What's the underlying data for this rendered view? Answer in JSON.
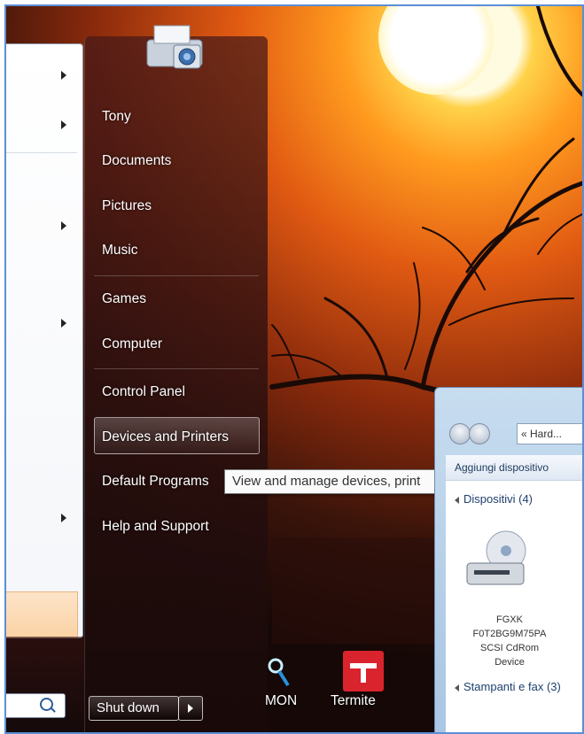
{
  "start_menu": {
    "right_items": [
      "Tony",
      "Documents",
      "Pictures",
      "Music",
      "Games",
      "Computer",
      "Control Panel",
      "Devices and Printers",
      "Default Programs",
      "Help and Support"
    ],
    "selected_item": "Devices and Printers",
    "shutdown_label": "Shut down"
  },
  "tooltip": {
    "text": "View and manage devices, print"
  },
  "desktop_icons": [
    {
      "label": "MON",
      "icon": "wrench-magnifier-icon"
    },
    {
      "label": "Termite",
      "icon": "termite-icon"
    }
  ],
  "explorer": {
    "address": "« Hard...",
    "toolbar_button": "Aggiungi dispositivo",
    "groups": [
      {
        "label": "Dispositivi (4)"
      },
      {
        "label": "Stampanti e fax (3)"
      }
    ],
    "device_lines": [
      "FGXK",
      "F0T2BG9M75PA",
      "SCSI CdRom",
      "Device"
    ]
  },
  "colors": {
    "accent_border": "#5b8fd6",
    "termite_red": "#d9232d"
  }
}
